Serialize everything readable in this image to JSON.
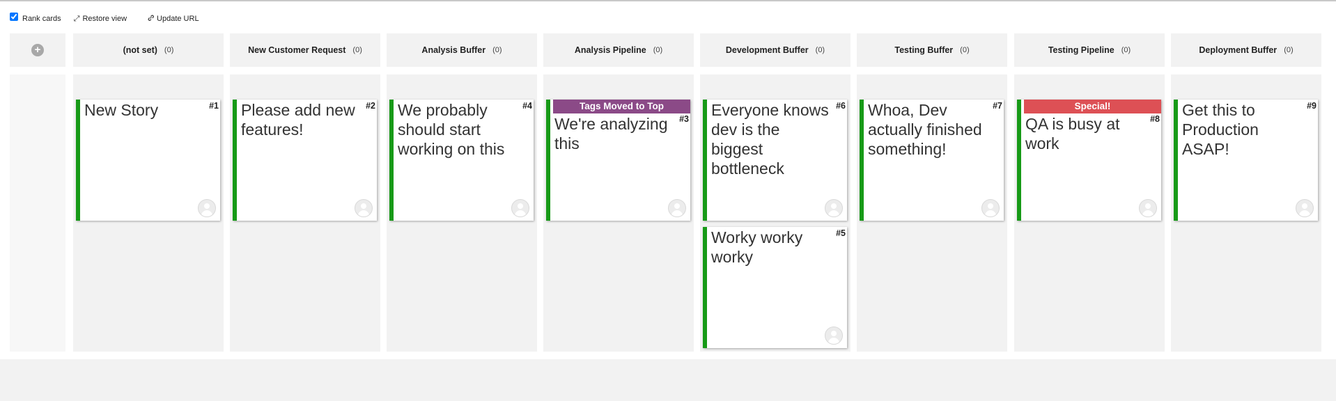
{
  "toolbar": {
    "rank_cards_label": "Rank cards",
    "rank_cards_checked": true,
    "restore_view_label": "Restore view",
    "update_url_label": "Update URL"
  },
  "add_column_icon": "plus-circle-icon",
  "columns": [
    {
      "title": "(not set)",
      "count": "(0)"
    },
    {
      "title": "New Customer Request",
      "count": "(0)"
    },
    {
      "title": "Analysis Buffer",
      "count": "(0)"
    },
    {
      "title": "Analysis Pipeline",
      "count": "(0)"
    },
    {
      "title": "Development Buffer",
      "count": "(0)"
    },
    {
      "title": "Testing Buffer",
      "count": "(0)"
    },
    {
      "title": "Testing Pipeline",
      "count": "(0)"
    },
    {
      "title": "Deployment Buffer",
      "count": "(0)"
    }
  ],
  "cards": [
    {
      "column": 0,
      "slot": 0,
      "id": "#1",
      "title": "New Story",
      "tag": null
    },
    {
      "column": 1,
      "slot": 0,
      "id": "#2",
      "title": "Please add new features!",
      "tag": null
    },
    {
      "column": 2,
      "slot": 0,
      "id": "#4",
      "title": "We probably should start working on this",
      "tag": null
    },
    {
      "column": 3,
      "slot": 0,
      "id": "#3",
      "title": "We're analyzing this",
      "tag": {
        "label": "Tags Moved to Top",
        "color": "#8b4a87"
      }
    },
    {
      "column": 4,
      "slot": 0,
      "id": "#6",
      "title": "Everyone knows dev is the biggest bottleneck",
      "tag": null
    },
    {
      "column": 4,
      "slot": 1,
      "id": "#5",
      "title": "Worky worky worky",
      "tag": null
    },
    {
      "column": 5,
      "slot": 0,
      "id": "#7",
      "title": "Whoa, Dev actually finished something!",
      "tag": null
    },
    {
      "column": 6,
      "slot": 0,
      "id": "#8",
      "title": "QA is busy at work",
      "tag": {
        "label": "Special!",
        "color": "#dd5055"
      }
    },
    {
      "column": 7,
      "slot": 0,
      "id": "#9",
      "title": "Get this to Production ASAP!",
      "tag": null
    }
  ],
  "colors": {
    "card_accent": "#179a17",
    "column_bg": "#f2f2f2"
  }
}
